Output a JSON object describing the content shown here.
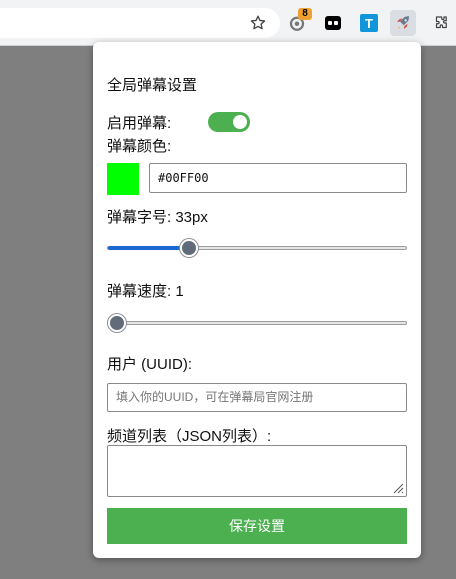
{
  "toolbar": {
    "icons": [
      "star-icon",
      "extension-badge-icon",
      "bilibili-icon",
      "translate-icon",
      "rocket-icon",
      "puzzle-icon"
    ],
    "badge_count": "8",
    "translate_letter": "T"
  },
  "popup": {
    "title": "全局弹幕设置",
    "enable_label": "启用弹幕:",
    "enabled": true,
    "color_label": "弹幕颜色:",
    "color_value": "#00FF00",
    "size_label": "弹幕字号: 33px",
    "size_fraction": 0.27,
    "speed_label": "弹幕速度: 1",
    "speed_fraction": 0.0,
    "uuid_label": "用户 (UUID):",
    "uuid_placeholder": "填入你的UUID，可在弹幕局官网注册",
    "channels_label": "频道列表（JSON列表）:",
    "save_label": "保存设置"
  },
  "colors": {
    "accent_green": "#4caf50",
    "slider_blue": "#1a67d2",
    "swatch": "#00ff00"
  }
}
